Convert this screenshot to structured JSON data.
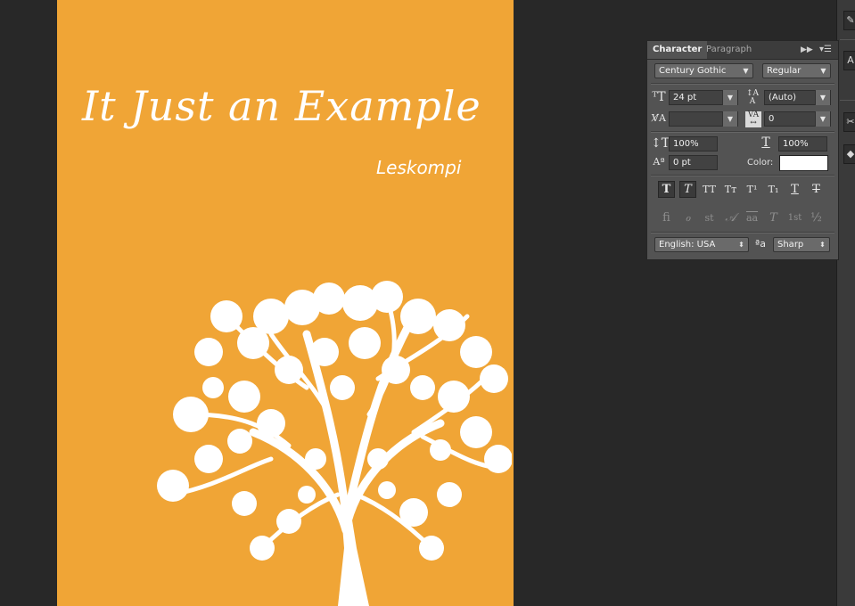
{
  "document": {
    "title": "It Just an Example",
    "author": "Leskompi",
    "background_color": "#f0a536"
  },
  "panel": {
    "tabs": [
      {
        "label": "Character",
        "active": true
      },
      {
        "label": "Paragraph",
        "active": false
      }
    ],
    "collapse_icon": "double-chevron-right-icon",
    "menu_icon": "panel-menu-icon",
    "font_family": "Century Gothic",
    "font_style": "Regular",
    "font_size": "24 pt",
    "leading": "(Auto)",
    "kerning": "",
    "tracking": "0",
    "vertical_scale": "100%",
    "horizontal_scale": "100%",
    "baseline_shift": "0 pt",
    "color_label": "Color:",
    "color_value": "#ffffff",
    "style_buttons": [
      {
        "glyph": "T",
        "name": "faux-bold-icon",
        "active": true
      },
      {
        "glyph": "T",
        "name": "faux-italic-icon",
        "active": true
      },
      {
        "glyph": "TT",
        "name": "all-caps-icon",
        "active": false
      },
      {
        "glyph": "Tᴛ",
        "name": "small-caps-icon",
        "active": false
      },
      {
        "glyph": "T¹",
        "name": "superscript-icon",
        "active": false
      },
      {
        "glyph": "T₁",
        "name": "subscript-icon",
        "active": false
      },
      {
        "glyph": "T",
        "name": "underline-icon",
        "active": false
      },
      {
        "glyph": "T",
        "name": "strikethrough-icon",
        "active": false
      }
    ],
    "opentype_buttons": [
      {
        "glyph": "fi",
        "name": "ligatures-icon"
      },
      {
        "glyph": "ℴ",
        "name": "discretionary-ligatures-icon"
      },
      {
        "glyph": "st",
        "name": "swash-icon"
      },
      {
        "glyph": "𝒜",
        "name": "stylistic-alternates-icon"
      },
      {
        "glyph": "aa",
        "name": "titling-alternates-icon"
      },
      {
        "glyph": "T",
        "name": "ornaments-icon"
      },
      {
        "glyph": "1st",
        "name": "ordinals-icon"
      },
      {
        "glyph": "½",
        "name": "fractions-icon"
      }
    ],
    "language": "English: USA",
    "anti_alias_icon": "anti-alias-icon",
    "anti_alias_glyph": "ªa",
    "anti_alias": "Sharp"
  },
  "right_strip": {
    "buttons": [
      {
        "name": "brush-icon"
      },
      {
        "name": "type-tool-icon",
        "glyph": "A"
      },
      {
        "name": "tools-icon"
      },
      {
        "name": "cube-icon"
      }
    ]
  }
}
